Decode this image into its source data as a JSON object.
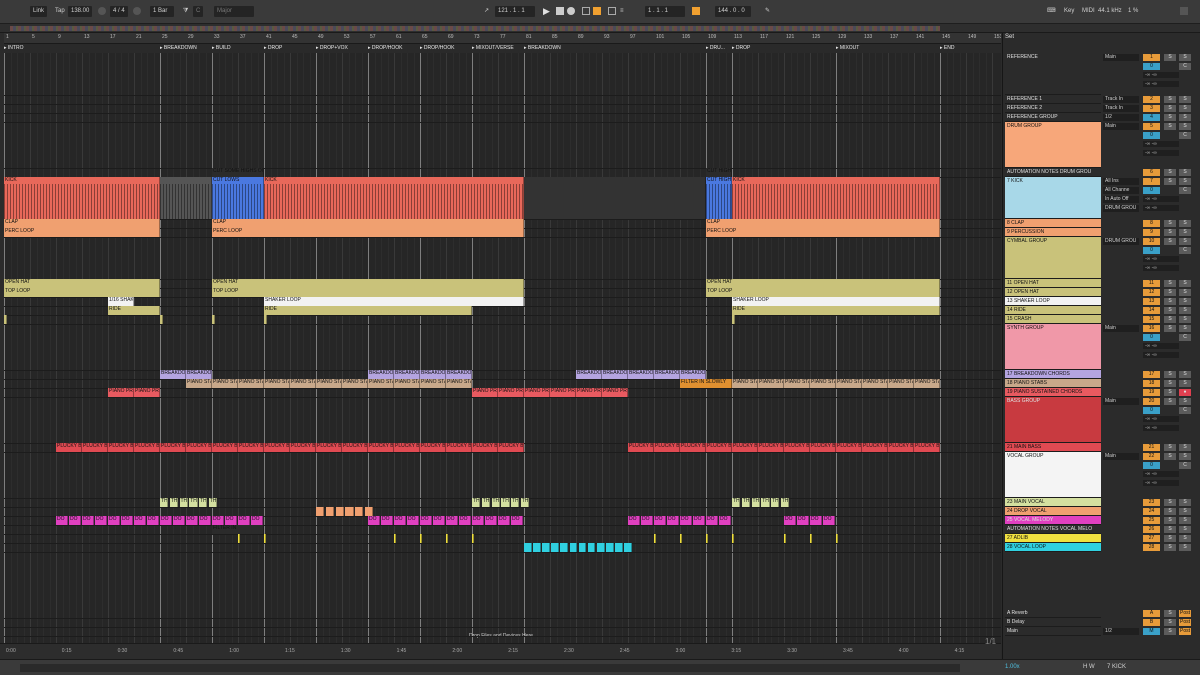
{
  "topbar": {
    "link": "Link",
    "tap": "Tap",
    "tempo": "138.00",
    "sig": "4 / 4",
    "quant": "1 Bar",
    "key": "C",
    "scale": "Major",
    "pos": "121 .  1 .  1",
    "punch": "1 .  1 .  1",
    "len": "144 .  0 .  0",
    "key_label": "Key",
    "midi_label": "MIDI",
    "sample_rate": "44.1 kHz",
    "cpu": "1 %"
  },
  "ruler": {
    "bars": [
      "1",
      "5",
      "9",
      "13",
      "17",
      "21",
      "25",
      "29",
      "33",
      "37",
      "41",
      "45",
      "49",
      "53",
      "57",
      "61",
      "65",
      "69",
      "73",
      "77",
      "81",
      "85",
      "89",
      "93",
      "97",
      "101",
      "105",
      "109",
      "113",
      "117",
      "121",
      "125",
      "129",
      "133",
      "137",
      "141",
      "145",
      "149",
      "153"
    ]
  },
  "locators": [
    {
      "label": "INTRO",
      "bar": 1
    },
    {
      "label": "BREAKDOWN",
      "bar": 25
    },
    {
      "label": "BUILD",
      "bar": 33
    },
    {
      "label": "DROP",
      "bar": 41
    },
    {
      "label": "DROP+VOX",
      "bar": 49
    },
    {
      "label": "DROP/HOOK",
      "bar": 57
    },
    {
      "label": "DROP/HOOK",
      "bar": 65
    },
    {
      "label": "MIXOUT/VERSE",
      "bar": 73
    },
    {
      "label": "BREAKDOWN",
      "bar": 81
    },
    {
      "label": "DRU...",
      "bar": 109
    },
    {
      "label": "DROP",
      "bar": 113
    },
    {
      "label": "MIXOUT",
      "bar": 129
    },
    {
      "label": "END",
      "bar": 145
    }
  ],
  "time_axis": [
    "0:00",
    "0:15",
    "0:30",
    "0:45",
    "1:00",
    "1:15",
    "1:30",
    "1:45",
    "2:00",
    "2:15",
    "2:30",
    "2:45",
    "3:00",
    "3:15",
    "3:30",
    "3:45",
    "4:00",
    "4:15"
  ],
  "drop_message": "Drop Files and Devices Here",
  "clip_labels": {
    "cut_highs": "CUT SOME HIGHS OU",
    "cut_lows": "CUT LOWS",
    "kick": "KICK",
    "cut_high": "CUT HIGH",
    "clap": "CLAP",
    "perc": "PERC LOOP",
    "open_hat": "OPEN HAT",
    "top_loop": "TOP LOOP",
    "shaker": "SHAKER LOOP",
    "ride": "RIDE",
    "breakdown": "BREAKDO",
    "piano_stabs": "PIANO STABS",
    "piano_pr": "PIANO PR",
    "plucky": "PLUCKY BASS",
    "filter_in": "FILTER IN",
    "filter_slowly": "FILTER IN SLOWLY",
    "do": "DO",
    "vocal_mel": "TH",
    "vocal": "AL"
  },
  "tracks": [
    {
      "name": "REFERENCE",
      "io": "Main",
      "num": "1"
    },
    {
      "name": "REFERENCE 1",
      "io": "Track In",
      "num": "2"
    },
    {
      "name": "REFERENCE 2",
      "io": "Track In",
      "num": "3"
    },
    {
      "name": "REFERENCE GROUP",
      "io": "1/2",
      "num": "4"
    },
    {
      "name": "DRUM GROUP",
      "io": "Main",
      "num": "5"
    },
    {
      "name": "AUTOMATION NOTES DRUM GROU",
      "io": "",
      "num": "6"
    },
    {
      "name": "7 KICK",
      "io": "All Ins",
      "io2": "All Channe",
      "io3": "In  Auto  Off",
      "io4": "DRUM GROU",
      "num": "7"
    },
    {
      "name": "8 CLAP",
      "io": "",
      "num": "8"
    },
    {
      "name": "9 PERCUSSION",
      "io": "",
      "num": "9"
    },
    {
      "name": "CYMBAL GROUP",
      "io": "DRUM GROU",
      "num": "10"
    },
    {
      "name": "11 OPEN HAT",
      "io": "",
      "num": "11"
    },
    {
      "name": "12 OPEN HAT",
      "io": "",
      "num": "12"
    },
    {
      "name": "13 SHAKER LOOP",
      "io": "",
      "num": "13"
    },
    {
      "name": "14 RIDE",
      "io": "",
      "num": "14"
    },
    {
      "name": "15 CRASH",
      "io": "",
      "num": "15"
    },
    {
      "name": "SYNTH GROUP",
      "io": "Main",
      "num": "16"
    },
    {
      "name": "17 BREAKDOWN CHORDS",
      "io": "",
      "num": "17"
    },
    {
      "name": "18 PIANO STABS",
      "io": "",
      "num": "18"
    },
    {
      "name": "19 PIANO SUSTAINED CHORDS",
      "io": "",
      "num": "19"
    },
    {
      "name": "BASS GROUP",
      "io": "Main",
      "num": "20"
    },
    {
      "name": "21 MAIN BASS",
      "io": "",
      "num": "21"
    },
    {
      "name": "VOCAL GROUP",
      "io": "Main",
      "num": "22"
    },
    {
      "name": "23 MAIN VOCAL",
      "io": "",
      "num": "23"
    },
    {
      "name": "24 DROP VOCAL",
      "io": "",
      "num": "24"
    },
    {
      "name": "25 VOCAL MELODY",
      "io": "",
      "num": "25"
    },
    {
      "name": "AUTOMATION NOTES VOCAL MELO",
      "io": "",
      "num": "26"
    },
    {
      "name": "27 ADLIB",
      "io": "",
      "num": "27"
    },
    {
      "name": "28 VOCAL LOOP",
      "io": "",
      "num": "28"
    },
    {
      "name": "A Reverb",
      "io": "",
      "num": "A"
    },
    {
      "name": "B Delay",
      "io": "",
      "num": "B"
    },
    {
      "name": "Main",
      "io": "1/2",
      "num": "M"
    }
  ],
  "mixer": {
    "s": "S",
    "r": "R",
    "c": "C",
    "vol": "0",
    "inf": "-∞",
    "post": "Post"
  },
  "set_label": "Set",
  "page_count": "1/1",
  "status": {
    "zoom": "1.00x",
    "hw": "H  W",
    "track": "7 KICK"
  },
  "colors": {
    "kick": "#e8685a",
    "clap": "#f0a070",
    "drum_group": "#f7a77a",
    "hat": "#c9c27a",
    "shaker": "#f2f2f2",
    "synth_group": "#f098a8",
    "breakdown": "#b4a4e0",
    "piano_stabs": "#c8a88a",
    "piano_sus": "#e85a60",
    "bass_group": "#c83a40",
    "bass": "#e04a52",
    "main_vocal": "#d4e0a0",
    "drop_vocal": "#f0a070",
    "vocal_melody": "#e040c0",
    "adlib": "#f0e040",
    "vocal_loop": "#30d0e0",
    "cut_lows": "#4a78e0",
    "kick_track": "#a8d8e8"
  }
}
